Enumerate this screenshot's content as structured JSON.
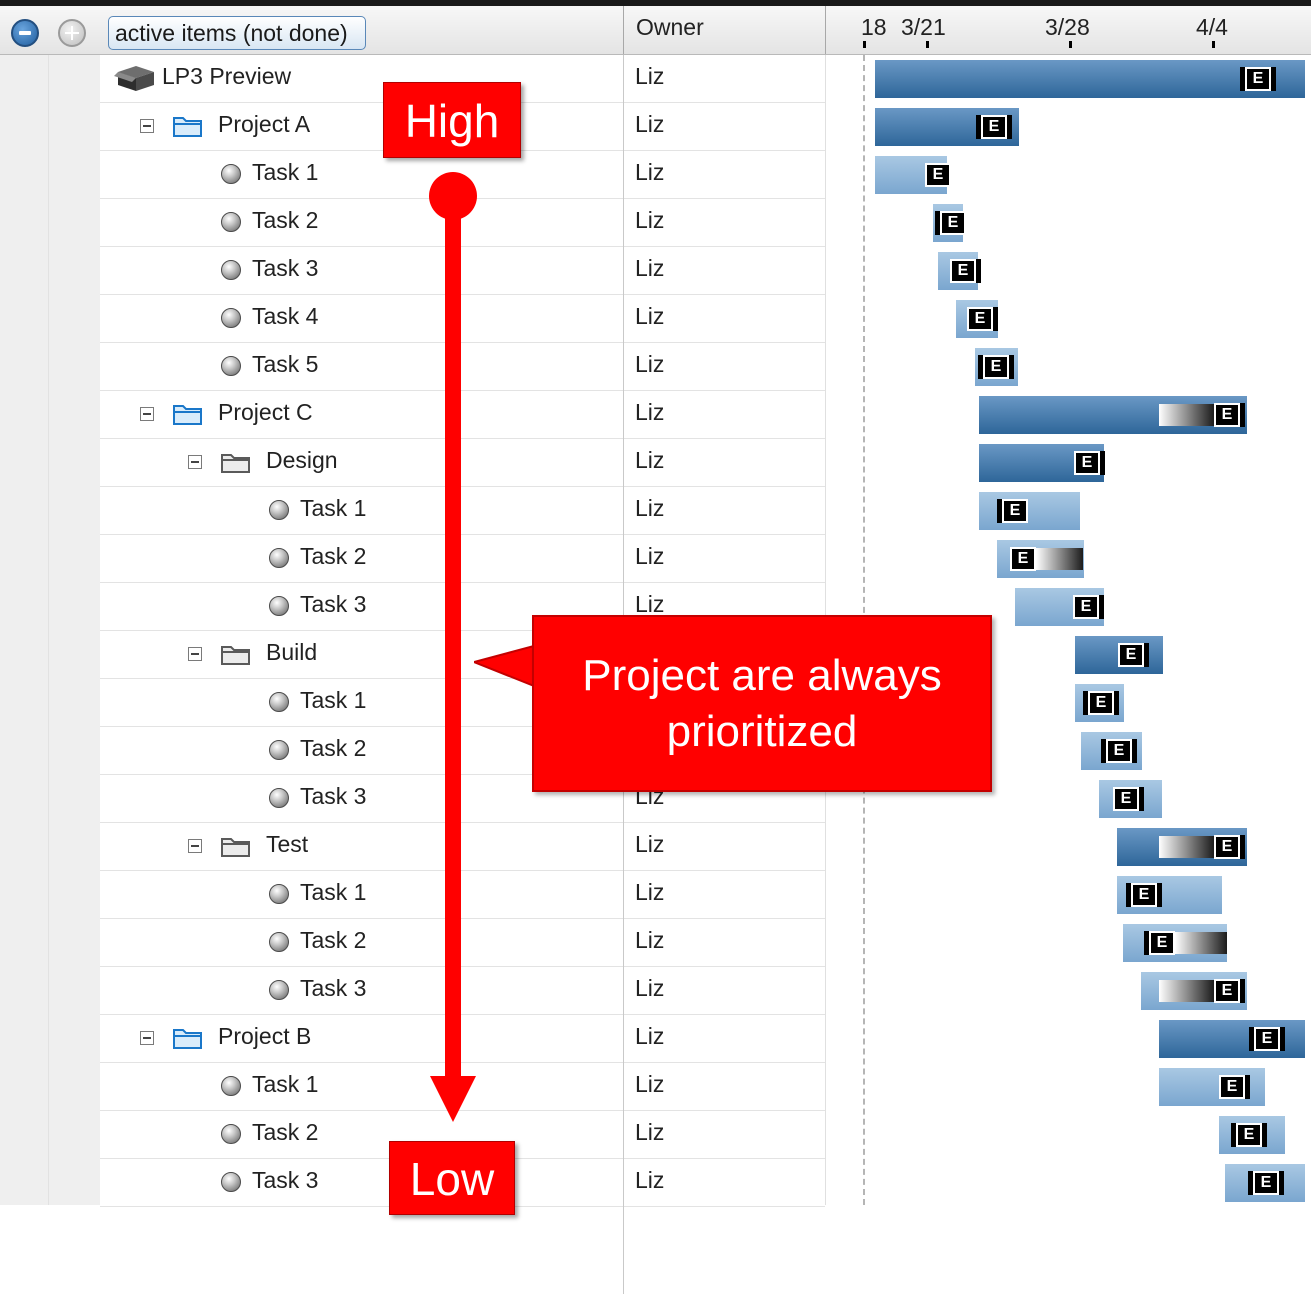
{
  "header": {
    "filter_label": "active items (not done)",
    "owner_column": "Owner",
    "dates": [
      "18",
      "3/21",
      "3/28",
      "4/4"
    ]
  },
  "rows": [
    {
      "label": "LP3 Preview",
      "owner": "Liz",
      "type": "package"
    },
    {
      "label": "Project A",
      "owner": "Liz",
      "type": "project"
    },
    {
      "label": "Task 1",
      "owner": "Liz",
      "type": "task"
    },
    {
      "label": "Task 2",
      "owner": "Liz",
      "type": "task"
    },
    {
      "label": "Task 3",
      "owner": "Liz",
      "type": "task"
    },
    {
      "label": "Task 4",
      "owner": "Liz",
      "type": "task"
    },
    {
      "label": "Task 5",
      "owner": "Liz",
      "type": "task"
    },
    {
      "label": "Project C",
      "owner": "Liz",
      "type": "project"
    },
    {
      "label": "Design",
      "owner": "Liz",
      "type": "subfolder"
    },
    {
      "label": "Task 1",
      "owner": "Liz",
      "type": "task"
    },
    {
      "label": "Task 2",
      "owner": "Liz",
      "type": "task"
    },
    {
      "label": "Task 3",
      "owner": "Liz",
      "type": "task"
    },
    {
      "label": "Build",
      "owner": "Liz",
      "type": "subfolder"
    },
    {
      "label": "Task 1",
      "owner": "Liz",
      "type": "task"
    },
    {
      "label": "Task 2",
      "owner": "Liz",
      "type": "task"
    },
    {
      "label": "Task 3",
      "owner": "Liz",
      "type": "task"
    },
    {
      "label": "Test",
      "owner": "Liz",
      "type": "subfolder"
    },
    {
      "label": "Task 1",
      "owner": "Liz",
      "type": "task"
    },
    {
      "label": "Task 2",
      "owner": "Liz",
      "type": "task"
    },
    {
      "label": "Task 3",
      "owner": "Liz",
      "type": "task"
    },
    {
      "label": "Project B",
      "owner": "Liz",
      "type": "project"
    },
    {
      "label": "Task 1",
      "owner": "Liz",
      "type": "task"
    },
    {
      "label": "Task 2",
      "owner": "Liz",
      "type": "task"
    },
    {
      "label": "Task 3",
      "owner": "Liz",
      "type": "task"
    }
  ],
  "gantt": {
    "marker_label": "E"
  },
  "annotations": {
    "high": "High",
    "low": "Low",
    "callout": "Project are always prioritized"
  },
  "colors": {
    "annotation_red": "#ff0000",
    "bar_dark": "#2e6699",
    "bar_light": "#7aa6cf"
  }
}
